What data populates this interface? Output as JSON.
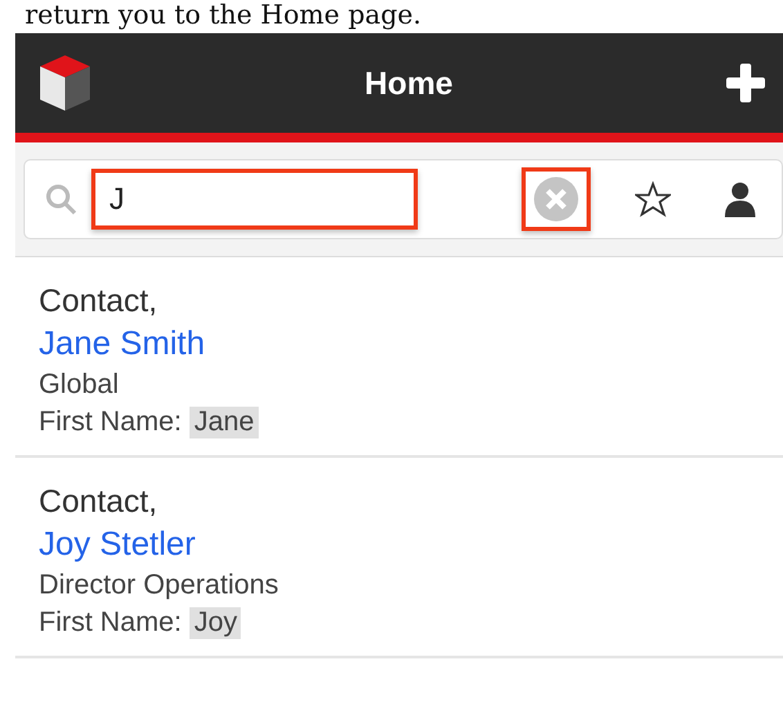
{
  "doc_text": "return you to the Home page.",
  "header": {
    "title": "Home"
  },
  "search": {
    "value": "J"
  },
  "results": [
    {
      "module": "Contact,",
      "name": "Jane Smith",
      "detail": "Global",
      "match_label": "First Name:",
      "match_value": "Jane"
    },
    {
      "module": "Contact,",
      "name": "Joy Stetler",
      "detail": "Director Operations",
      "match_label": "First Name:",
      "match_value": "Joy"
    }
  ]
}
